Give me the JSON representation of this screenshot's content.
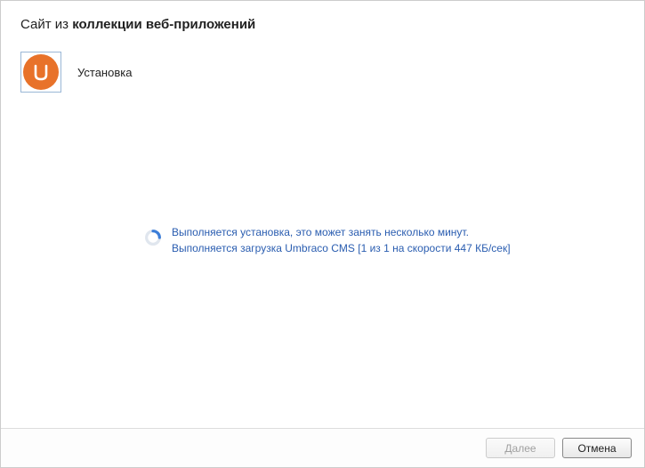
{
  "header": {
    "prefix": "Сайт из ",
    "bold": "коллекции веб-приложений"
  },
  "app": {
    "icon_name": "umbraco-icon",
    "label": "Установка"
  },
  "status": {
    "line1": "Выполняется установка, это может занять несколько минут.",
    "line2": "Выполняется загрузка Umbraco CMS [1 из 1 на скорости 447 КБ/сек]"
  },
  "footer": {
    "next_label": "Далее",
    "cancel_label": "Отмена"
  },
  "colors": {
    "accent": "#2a5db0",
    "umbraco_orange": "#e8722a"
  }
}
